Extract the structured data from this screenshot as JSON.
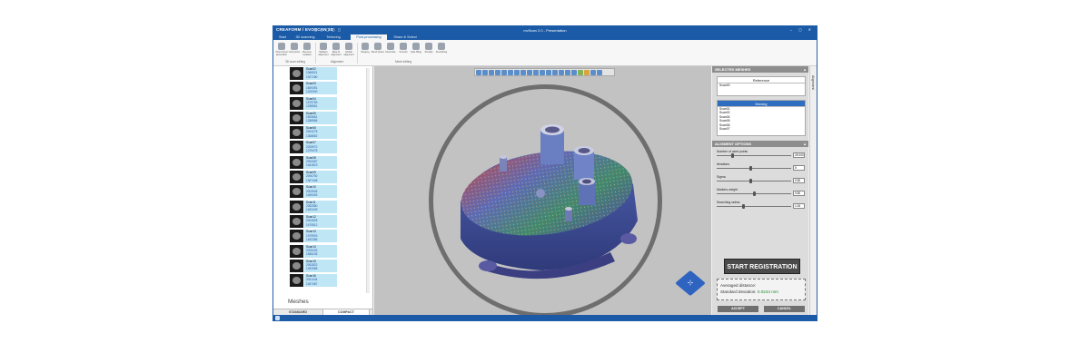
{
  "app": {
    "logo": "CREAFORM / EVOSCAN 3D",
    "title": "mvScan 2.0 - Presentation",
    "quick_access": "◻ ◻ ◻ ◻ ◻",
    "window_controls": "– ◻ ✕"
  },
  "tabs": [
    "Start",
    "3D scanning",
    "Texturing",
    "Post-processing",
    "Share & Select"
  ],
  "ribbon": {
    "buttons": [
      "Point cloud generation",
      "Grid points",
      "Remove isolated",
      "Markers alignment",
      "Best-fit alignment",
      "Global alignment",
      "Merging",
      "Mesh fusion",
      "Decimate",
      "Smooth",
      "Hole filling",
      "Simplify",
      "Smoothing"
    ],
    "groups": [
      "3D scan editing",
      "Alignment",
      "Mesh editing"
    ]
  },
  "scans": [
    {
      "name": "Scan02",
      "v1": "1366521",
      "v2": "1327180",
      "color": "#3b6fd4"
    },
    {
      "name": "Scan03",
      "v1": "1609391",
      "v2": "1225300",
      "color": "#2d8c3a"
    },
    {
      "name": "Scan04",
      "v1": "1575769",
      "v2": "1298551",
      "color": "#cf3b2f"
    },
    {
      "name": "Scan05",
      "v1": "1509661",
      "v2": "1288586",
      "color": "#2e6fbf"
    },
    {
      "name": "Scan06",
      "v1": "2004275",
      "v2": "1368852",
      "color": "#8bbd3c"
    },
    {
      "name": "Scan07",
      "v1": "2025972",
      "v2": "1375478",
      "color": "#7a3fb8"
    },
    {
      "name": "Scan08",
      "v1": "2094367",
      "v2": "1461619",
      "color": "#2a9fa6"
    },
    {
      "name": "Scan09",
      "v1": "2006750",
      "v2": "1367448",
      "color": "#d6552a"
    },
    {
      "name": "Scan10",
      "v1": "2003945",
      "v2": "1469263",
      "color": "#2b5ea8"
    },
    {
      "name": "Scan11",
      "v1": "2082580",
      "v2": "1452449",
      "color": "#3f8d3a"
    },
    {
      "name": "Scan12",
      "v1": "2004505",
      "v2": "1475512",
      "color": "#c0392b"
    },
    {
      "name": "Scan13",
      "v1": "1979903",
      "v2": "1452386",
      "color": "#e0b022"
    },
    {
      "name": "Scan14",
      "v1": "2025433",
      "v2": "1556245",
      "color": "#2f74c8"
    },
    {
      "name": "Scan15",
      "v1": "2052822",
      "v2": "1392558",
      "color": "#3aa8c2"
    },
    {
      "name": "Scan16",
      "v1": "2041444",
      "v2": "1467487",
      "color": "#1f8f7a"
    }
  ],
  "left_panel": {
    "meshes_label": "Meshes",
    "tab_standard": "STANDARD",
    "tab_compact": "COMPACT"
  },
  "right_panel": {
    "selected_meshes_title": "SELECTED MESHES",
    "reference_label": "Reference",
    "reference_items": [
      "Scan00"
    ],
    "moving_label": "Moving",
    "moving_items": [
      "Scan01",
      "Scan02",
      "Scan04",
      "Scan05",
      "Scan06",
      "Scan07"
    ],
    "alignment_title": "ALIGMENT OPTIONS",
    "options": [
      {
        "label": "Number of used points",
        "value": "25 000",
        "level": 0.2
      },
      {
        "label": "Iterations",
        "value": "5",
        "level": 0.45
      },
      {
        "label": "Sigma",
        "value": "0.50",
        "level": 0.45
      },
      {
        "label": "Markers weight",
        "value": "0.50",
        "level": 0.5
      },
      {
        "label": "Searching radius",
        "value": "1.00",
        "level": 0.35
      }
    ],
    "start_button": "START REGISTRATION",
    "averaged_distance_label": "Averaged distance:",
    "std_dev_label": "Standard deviation:",
    "std_dev_value": "0.0244 mm",
    "accept_button": "ACCEPT",
    "cancel_button": "CANCEL",
    "side_tab": "Alignment"
  },
  "viewport": {
    "navcube_label": "⊹"
  },
  "colors": {
    "brand": "#1a5aa6",
    "viewport_bg": "#c2c2c2",
    "highlight": "#bfe6f5"
  }
}
